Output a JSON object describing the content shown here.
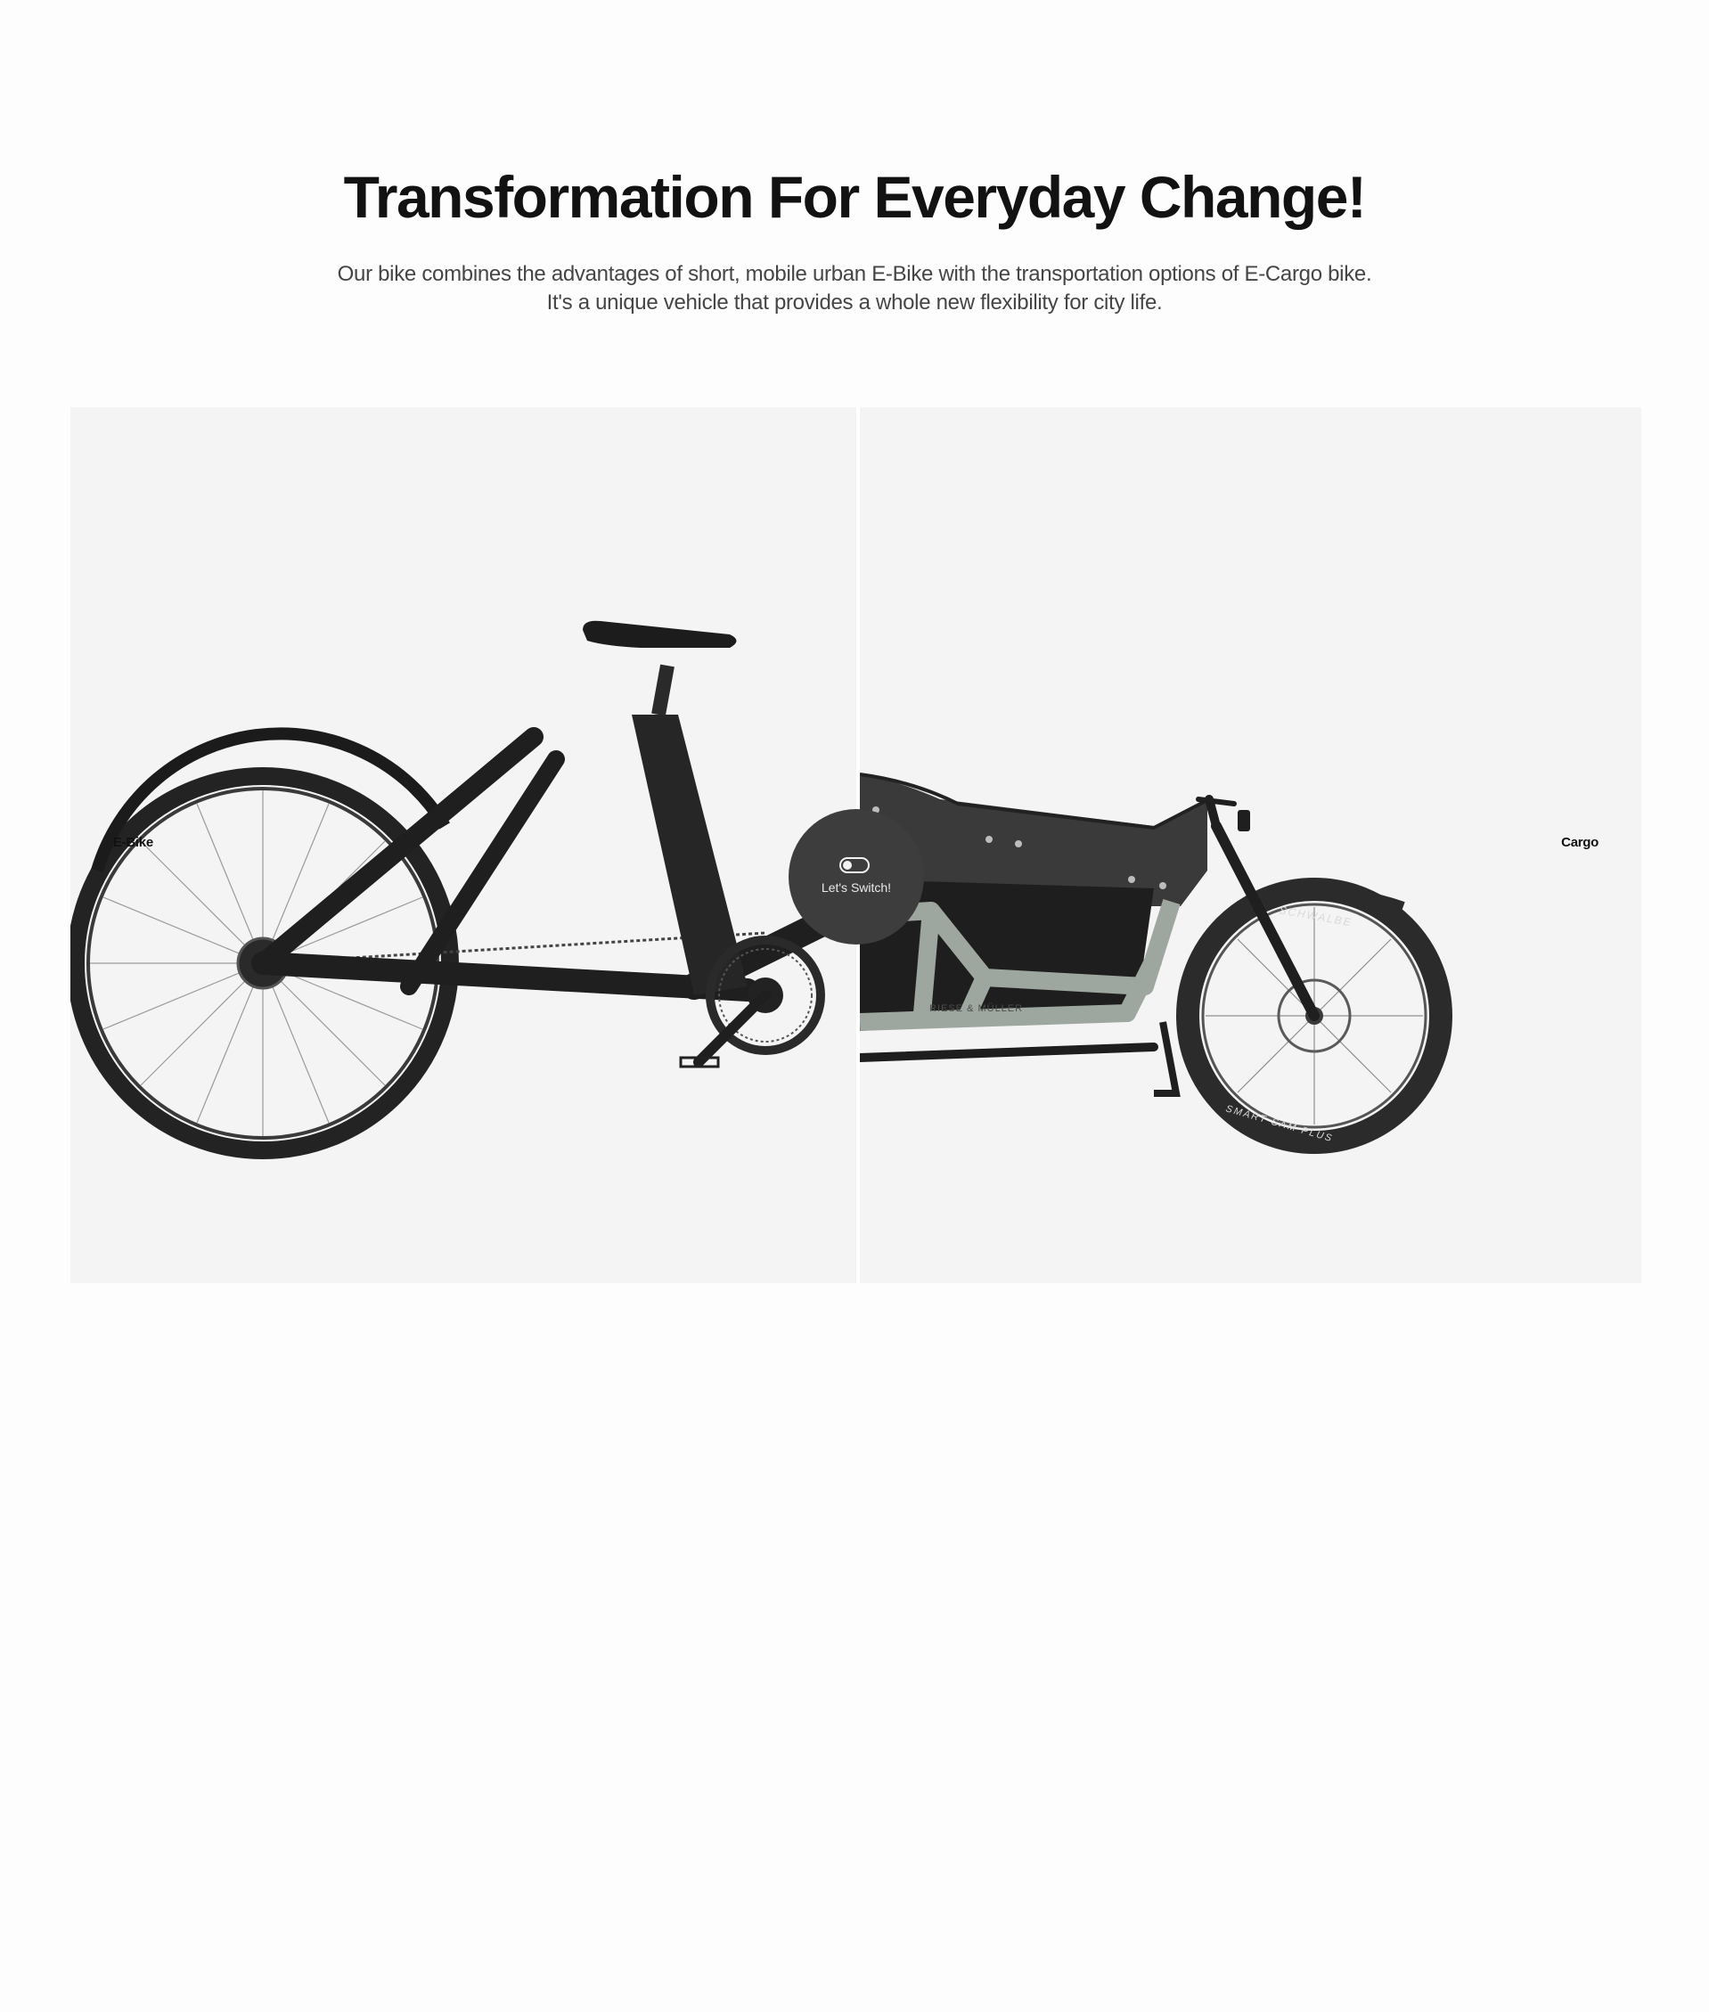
{
  "hero": {
    "title": "Transformation For Everyday Change!",
    "subtitle_line1": "Our bike combines the advantages of short, mobile urban E-Bike with the transportation options of E-Cargo bike.",
    "subtitle_line2": "It's a unique vehicle that provides a whole new flexibility for city life."
  },
  "compare": {
    "left_label": "E-Bike",
    "right_label": "Cargo",
    "switch_label": "Let's Switch!",
    "frame_brand": "RIESE & MÜLLER",
    "tire_text_top": "SCHWALBE",
    "tire_text_bottom": "SMART SAM PLUS"
  },
  "colors": {
    "panel_bg": "#f4f4f4",
    "handle_bg": "#3d3d3d",
    "ebike_frame": "#1f1f1f",
    "cargo_frame": "#9ea79f",
    "cargo_cover": "#3a3a3a"
  },
  "icons": {
    "switch": "toggle-icon"
  }
}
